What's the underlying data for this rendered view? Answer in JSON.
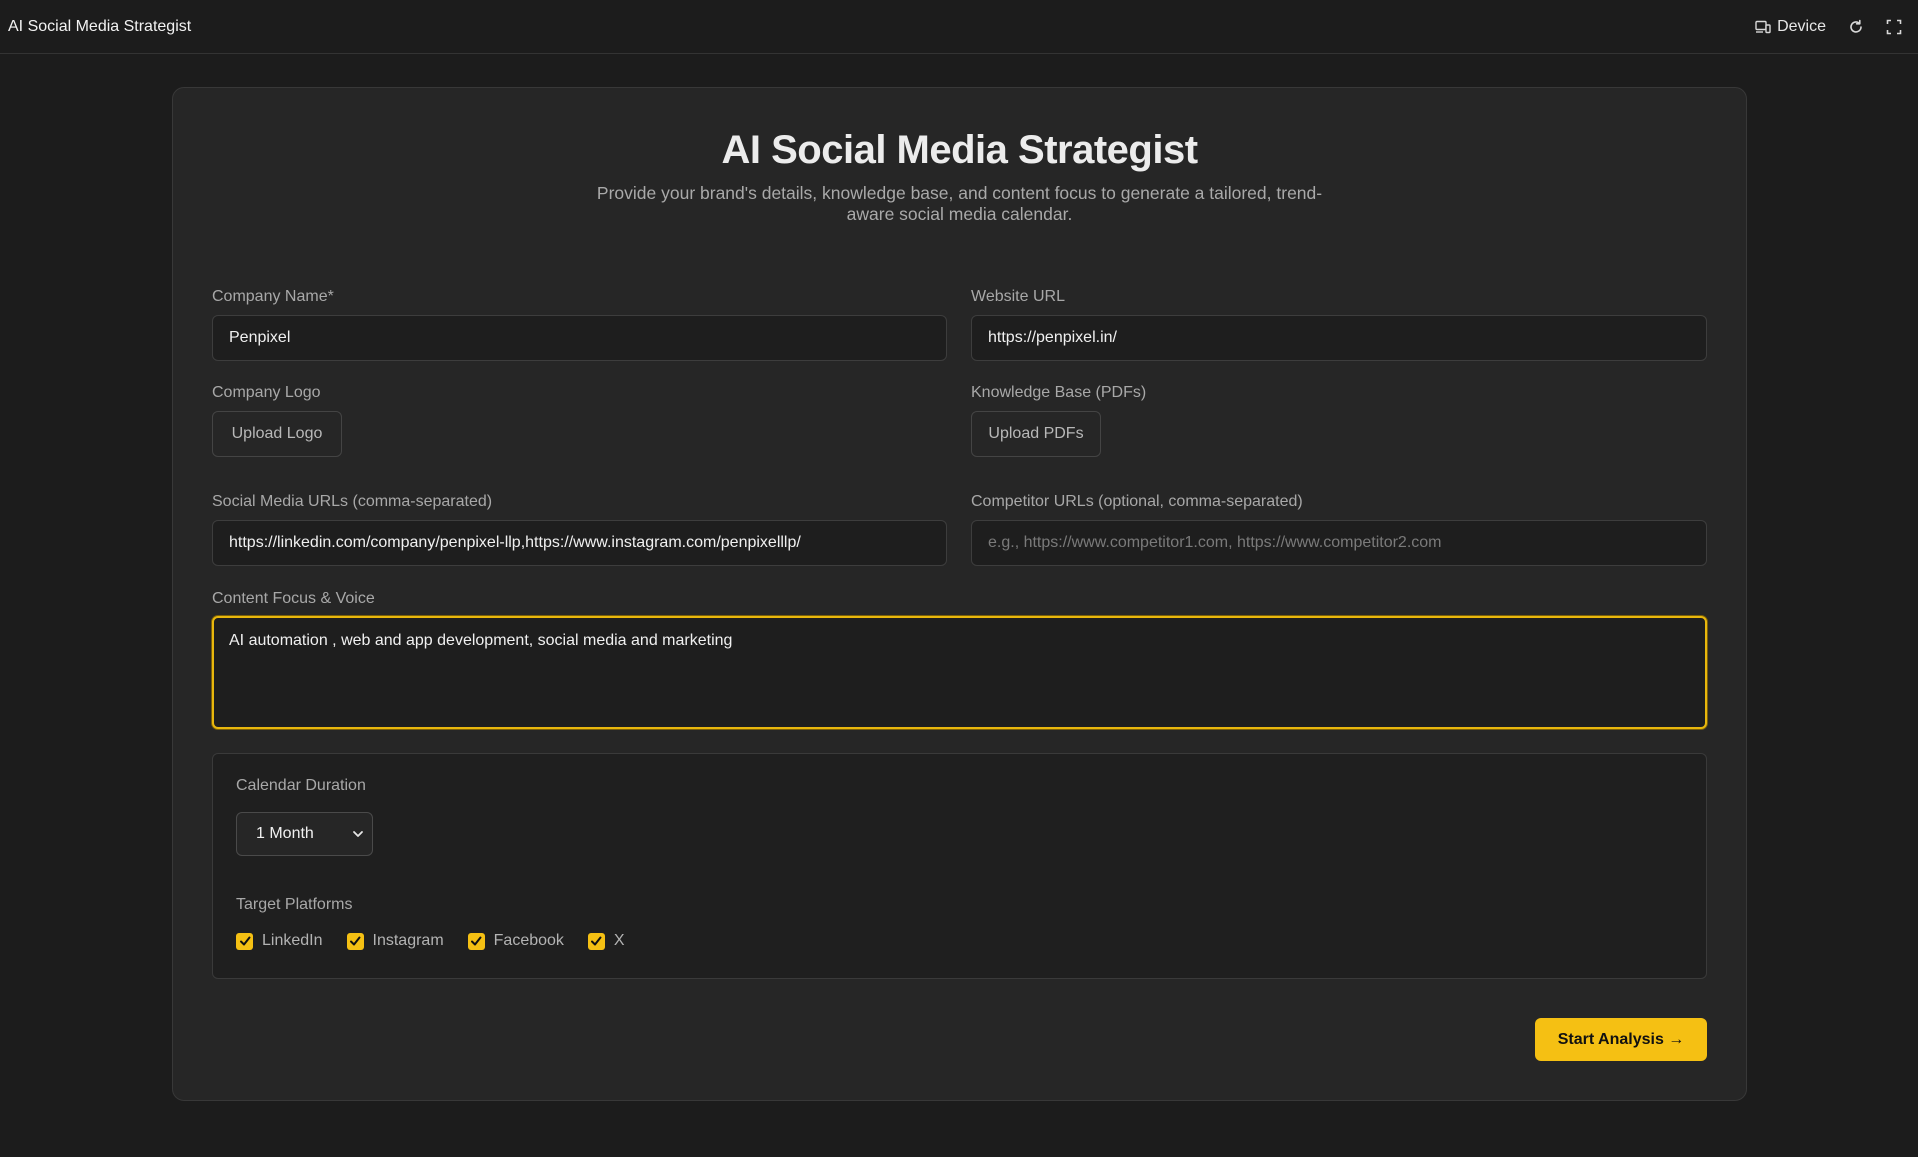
{
  "topbar": {
    "title": "AI Social Media Strategist",
    "device_label": "Device",
    "icons": [
      "device-icon",
      "refresh-icon",
      "fullscreen-icon"
    ]
  },
  "header": {
    "title": "AI Social Media Strategist",
    "subtitle": "Provide your brand's details, knowledge base, and content focus to generate a tailored, trend-aware social media calendar."
  },
  "form": {
    "company_name": {
      "label": "Company Name*",
      "value": "Penpixel"
    },
    "website_url": {
      "label": "Website URL",
      "value": "https://penpixel.in/"
    },
    "company_logo": {
      "label": "Company Logo",
      "button": "Upload Logo"
    },
    "knowledge_base": {
      "label": "Knowledge Base (PDFs)",
      "button": "Upload PDFs"
    },
    "social_urls": {
      "label": "Social Media URLs (comma-separated)",
      "value": "https://linkedin.com/company/penpixel-llp,https://www.instagram.com/penpixelllp/"
    },
    "competitor_urls": {
      "label": "Competitor URLs (optional, comma-separated)",
      "value": "",
      "placeholder": "e.g., https://www.competitor1.com, https://www.competitor2.com"
    },
    "content_focus": {
      "label": "Content Focus & Voice",
      "value": "AI automation , web and app development, social media and marketing"
    },
    "calendar_duration": {
      "label": "Calendar Duration",
      "selected": "1 Month"
    },
    "target_platforms": {
      "label": "Target Platforms",
      "options": [
        {
          "label": "LinkedIn",
          "checked": true
        },
        {
          "label": "Instagram",
          "checked": true
        },
        {
          "label": "Facebook",
          "checked": true
        },
        {
          "label": "X",
          "checked": true
        }
      ]
    },
    "submit_label": "Start Analysis →"
  },
  "colors": {
    "background": "#1c1c1c",
    "card": "#262626",
    "accent": "#f5c013",
    "focus_border": "#e8b70d"
  }
}
